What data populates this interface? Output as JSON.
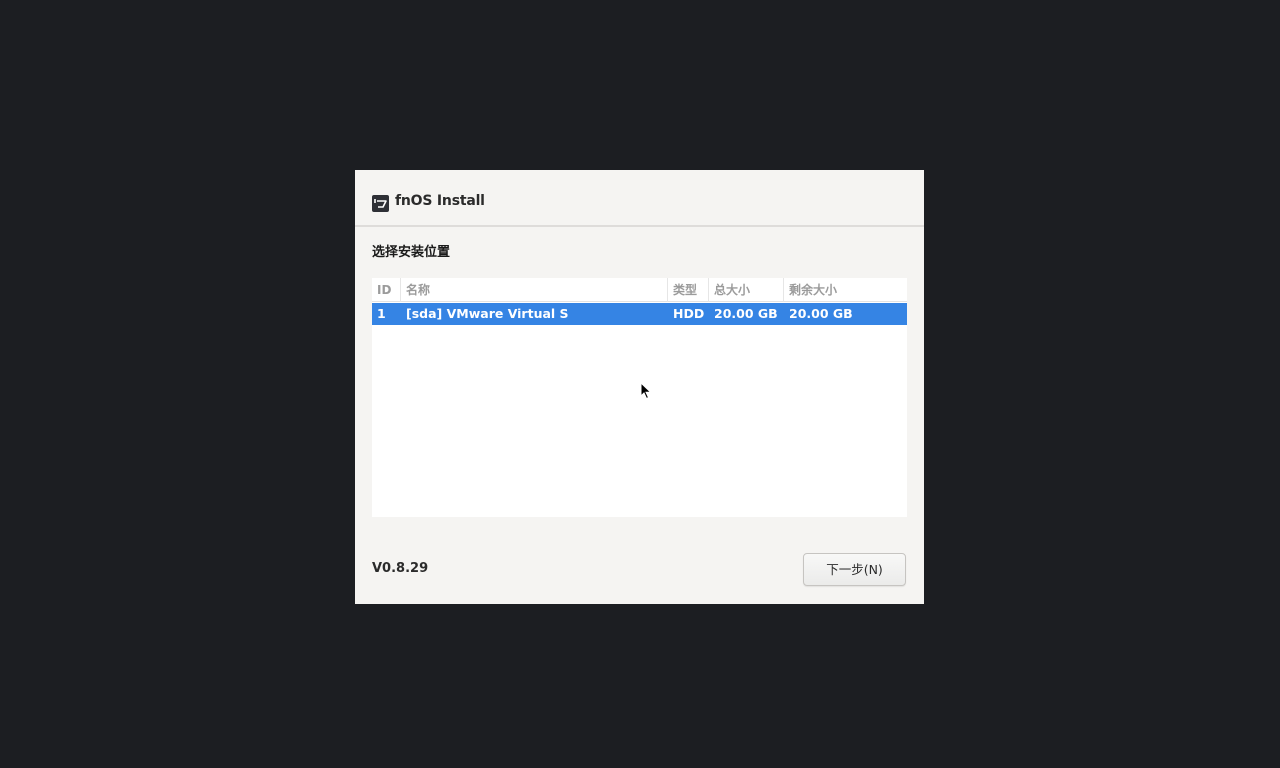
{
  "window": {
    "title": "fnOS Install"
  },
  "page": {
    "heading": "选择安装位置"
  },
  "disk_table": {
    "columns": [
      "ID",
      "名称",
      "类型",
      "总大小",
      "剩余大小"
    ],
    "rows": [
      {
        "id": "1",
        "name": "[sda] VMware Virtual S",
        "type": "HDD",
        "total": "20.00 GB",
        "free": "20.00 GB",
        "selected": true
      }
    ]
  },
  "footer": {
    "version": "V0.8.29",
    "next_label": "下一步(N)"
  },
  "colors": {
    "background": "#1c1e22",
    "dialog": "#f5f4f2",
    "selection": "#3584e4"
  }
}
